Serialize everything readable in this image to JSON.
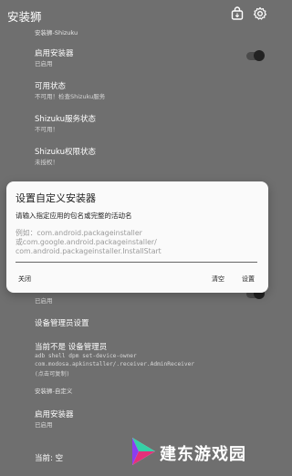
{
  "app_title": "安装狮",
  "top_icons": [
    "package-icon",
    "gear-icon"
  ],
  "section_shizuku": "安装狮-Shizuku",
  "items_top": [
    {
      "title": "启用安装器",
      "sub": "已启用"
    },
    {
      "title": "可用状态",
      "sub": "不可用！检查Shizuku服务"
    },
    {
      "title": "Shizuku服务状态",
      "sub": "不可用！"
    },
    {
      "title": "Shizuku权限状态",
      "sub": "未授权！"
    }
  ],
  "dialog": {
    "title": "设置自定义安装器",
    "message": "请输入指定应用的包名或完整的活动名",
    "placeholder": "例如：com.android.packageinstaller\n或com.google.android.packageinstaller/\ncom.android.packageinstaller.InstallStart",
    "close_label": "关闭",
    "clear_label": "清空",
    "set_label": "设置"
  },
  "items_bottom": [
    {
      "sub": "已启用"
    },
    {
      "title": "设备管理员设置"
    },
    {
      "title": "当前不是 设备管理员"
    }
  ],
  "adb_lines": [
    "adb shell dpm set-device-owner",
    "com.modosa.apkinstaller/.receiver.AdminReceiver",
    "(点击可复制)"
  ],
  "section_custom": "安装狮-自定义",
  "custom_items": [
    {
      "title": "启用安装器",
      "sub": "已启用"
    },
    {
      "title": "当前: 空"
    }
  ],
  "watermark_text": "建东游戏园"
}
